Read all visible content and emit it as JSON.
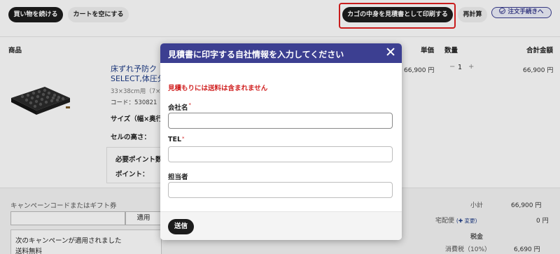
{
  "toolbar": {
    "continue_shopping": "買い物を続ける",
    "empty_cart": "カートを空にする",
    "print_estimate": "カゴの中身を見積書として印刷する",
    "recalculate": "再計算",
    "checkout": "注文手続きへ"
  },
  "cart_headers": {
    "product": "商品",
    "unit_price": "単価",
    "quantity": "数量",
    "total": "合計金額"
  },
  "item": {
    "title_line1": "床ずれ予防ク",
    "title_line2": "SELECT,体圧分",
    "size": "33×38cm用（7×8",
    "code": "コード：530821",
    "size_label": "サイズ（幅×奥行",
    "cell_height_label": "セルの高さ：",
    "required_points_label": "必要ポイント数",
    "points_label": "ポイント：",
    "unit_price": "66,900 円",
    "quantity": "1",
    "qty_minus": "−",
    "qty_plus": "+",
    "total": "66,900 円"
  },
  "campaign": {
    "label": "キャンペーンコードまたはギフト券",
    "input_value": "",
    "apply_label": "適用",
    "applied_msg": "次のキャンペーンが適用されました",
    "free_shipping": "送料無料"
  },
  "summary": {
    "subtotal_label": "小計",
    "subtotal_value": "66,900 円",
    "shipping_label": "宅配便",
    "change_label": "変更",
    "shipping_value": "0 円",
    "tax_label": "税金",
    "consumption_tax_label": "消費税（10%）",
    "consumption_tax_value": "6,690 円"
  },
  "modal": {
    "title": "見積書に印字する自社情報を入力してください",
    "notice": "見積もりには送料は含まれません",
    "company_label": "会社名",
    "company_value": "",
    "tel_label": "TEL",
    "tel_value": "",
    "person_label": "担当者",
    "person_value": "",
    "required_mark": "*",
    "submit_label": "送信"
  },
  "colors": {
    "modal_header": "#3c3f91",
    "notice_red": "#d01f1f",
    "highlight_red": "#e02020",
    "dark_button": "#1c1c1c"
  }
}
